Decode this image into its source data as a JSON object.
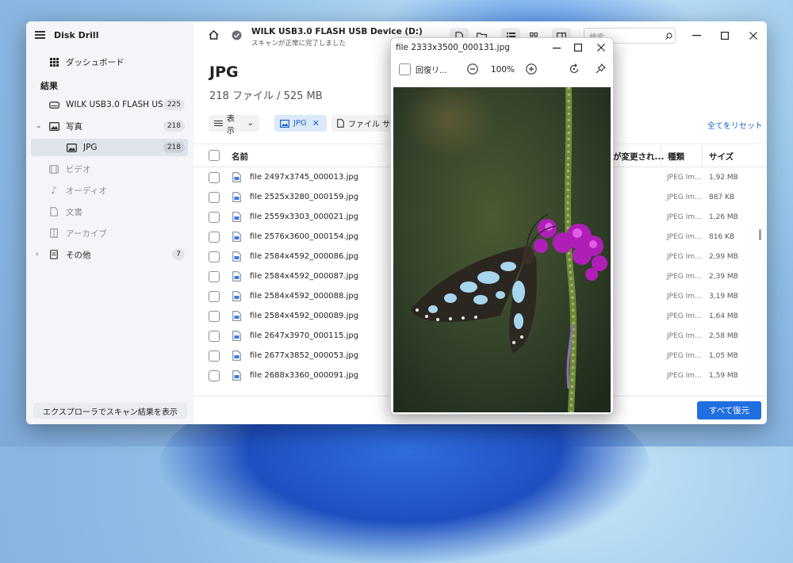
{
  "app": {
    "title": "Disk Drill"
  },
  "sidebar": {
    "dashboard": {
      "label": "ダッシュボード"
    },
    "section_label": "結果",
    "items": [
      {
        "label": "WILK USB3.0 FLASH USB...",
        "count": "225",
        "icon": "drive-icon"
      },
      {
        "label": "写真",
        "count": "218",
        "icon": "photo-icon"
      },
      {
        "label": "JPG",
        "count": "218",
        "icon": "image-icon"
      },
      {
        "label": "ビデオ",
        "count": "",
        "icon": "video-icon"
      },
      {
        "label": "オーディオ",
        "count": "",
        "icon": "music-icon"
      },
      {
        "label": "文書",
        "count": "",
        "icon": "document-icon"
      },
      {
        "label": "アーカイブ",
        "count": "",
        "icon": "archive-icon"
      },
      {
        "label": "その他",
        "count": "7",
        "icon": "other-icon"
      }
    ],
    "explorer_button": "エクスプローラでスキャン結果を表示"
  },
  "header": {
    "device_title": "WILK USB3.0 FLASH USB Device (D:)",
    "device_subtitle": "スキャンが正常に完了しました",
    "search_placeholder": "検索"
  },
  "main": {
    "title": "JPG",
    "subtitle": "218 ファイル / 525 MB",
    "filters": {
      "view": "表示",
      "type": "JPG",
      "size": "ファイル サイズ"
    },
    "reset_label": "全てをリセット",
    "columns": {
      "name": "名前",
      "modified": "が変更され...",
      "type": "種類",
      "size": "サイズ"
    },
    "rows": [
      {
        "name": "file 2497x3745_000013.jpg",
        "type": "JPEG Im...",
        "size": "1,92 MB"
      },
      {
        "name": "file 2525x3280_000159.jpg",
        "type": "JPEG Im...",
        "size": "887 KB"
      },
      {
        "name": "file 2559x3303_000021.jpg",
        "type": "JPEG Im...",
        "size": "1,26 MB"
      },
      {
        "name": "file 2576x3600_000154.jpg",
        "type": "JPEG Im...",
        "size": "816 KB"
      },
      {
        "name": "file 2584x4592_000086.jpg",
        "type": "JPEG Im...",
        "size": "2,99 MB"
      },
      {
        "name": "file 2584x4592_000087.jpg",
        "type": "JPEG Im...",
        "size": "2,39 MB"
      },
      {
        "name": "file 2584x4592_000088.jpg",
        "type": "JPEG Im...",
        "size": "3,19 MB"
      },
      {
        "name": "file 2584x4592_000089.jpg",
        "type": "JPEG Im...",
        "size": "1,64 MB"
      },
      {
        "name": "file 2647x3970_000115.jpg",
        "type": "JPEG Im...",
        "size": "2,58 MB"
      },
      {
        "name": "file 2677x3852_000053.jpg",
        "type": "JPEG Im...",
        "size": "1,05 MB"
      },
      {
        "name": "file 2688x3360_000091.jpg",
        "type": "JPEG Im...",
        "size": "1,59 MB"
      }
    ],
    "recover_all": "すべて復元"
  },
  "preview": {
    "title": "file 2333x3500_000131.jpg",
    "recover_label": "回復リ...",
    "zoom": "100%"
  },
  "colors": {
    "accent": "#1f6fe0",
    "sidebar_bg": "#f3f5f8"
  }
}
